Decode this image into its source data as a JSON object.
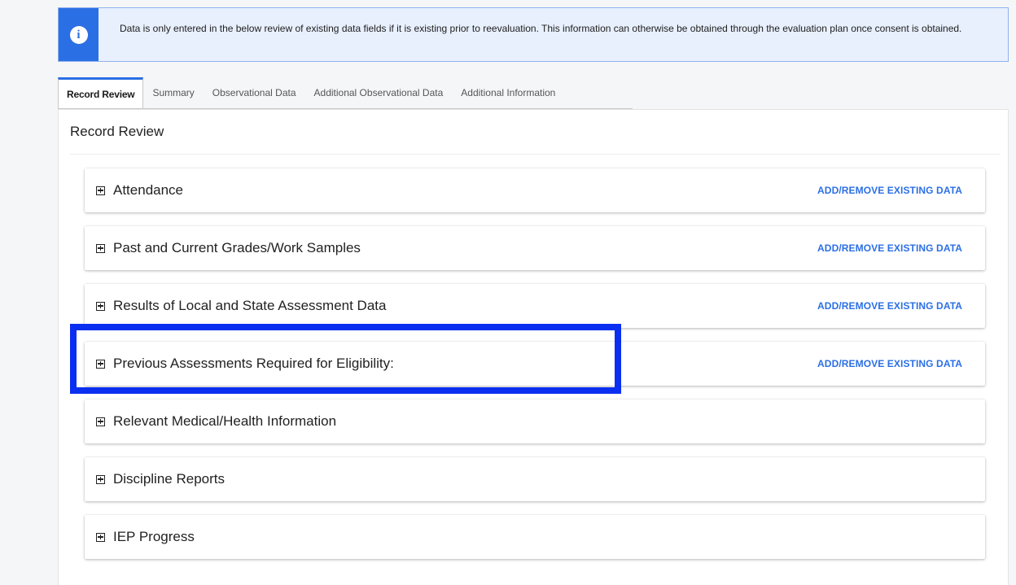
{
  "alert": {
    "icon": "info-icon",
    "message": "Data is only entered in the below review of existing data fields if it is existing prior to reevaluation. This information can otherwise be obtained through the evaluation plan once consent is obtained.",
    "accent_color": "#2b6fe4"
  },
  "tabs": [
    {
      "label": "Record Review",
      "active": true
    },
    {
      "label": "Summary",
      "active": false
    },
    {
      "label": "Observational Data",
      "active": false
    },
    {
      "label": "Additional Observational Data",
      "active": false
    },
    {
      "label": "Additional Information",
      "active": false
    }
  ],
  "panel": {
    "title": "Record Review"
  },
  "sections": [
    {
      "title": "Attendance",
      "action": "ADD/REMOVE EXISTING DATA"
    },
    {
      "title": "Past and Current Grades/Work Samples",
      "action": "ADD/REMOVE EXISTING DATA"
    },
    {
      "title": "Results of Local and State Assessment Data",
      "action": "ADD/REMOVE EXISTING DATA"
    },
    {
      "title": "Previous Assessments Required for Eligibility:",
      "action": "ADD/REMOVE EXISTING DATA"
    },
    {
      "title": "Relevant Medical/Health Information",
      "action": ""
    },
    {
      "title": "Discipline Reports",
      "action": ""
    },
    {
      "title": "IEP Progress",
      "action": ""
    }
  ],
  "highlight": {
    "color": "#0b2ff0",
    "target_section": "Previous Assessments Required for Eligibility:"
  }
}
